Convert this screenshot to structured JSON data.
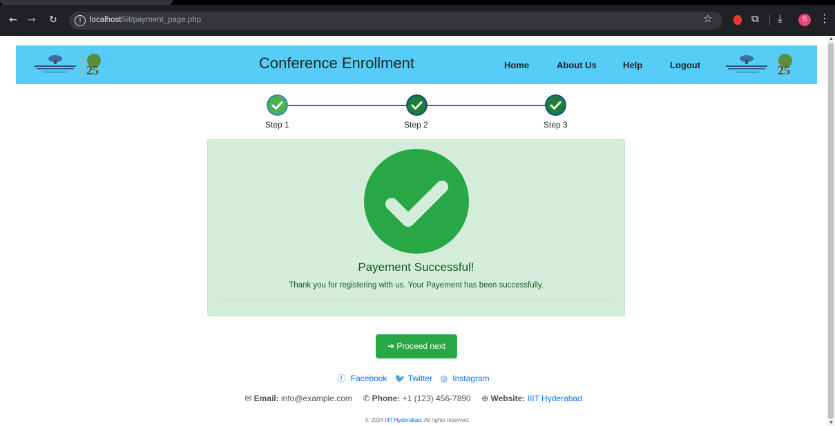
{
  "browser": {
    "url_host": "localhost",
    "url_path": "/iiit/payment_page.php",
    "avatar_letter": "S"
  },
  "header": {
    "brand": "Conference Enrollment",
    "nav": {
      "home": "Home",
      "about": "About Us",
      "help": "Help",
      "logout": "Logout"
    }
  },
  "steps": [
    {
      "label": "Step 1",
      "status": "completed"
    },
    {
      "label": "Step 2",
      "status": "completed"
    },
    {
      "label": "Step 3",
      "status": "completed"
    }
  ],
  "success": {
    "title": "Payement Successful!",
    "message": "Thank you for registering with us. Your Payement has been successfully."
  },
  "proceed_button": "➔ Proceed next",
  "footer": {
    "social": {
      "facebook": "Facebook",
      "twitter": "Twitter",
      "instagram": "Instagram"
    },
    "contact": {
      "email_label": "Email:",
      "email_value": "info@example.com",
      "phone_label": "Phone:",
      "phone_value": "+1 (123) 456-7890",
      "website_label": "Website:",
      "website_value": "IIIT Hyderabad"
    },
    "copyright_prefix": "© 2024",
    "copyright_link": "IIIT Hyderabad",
    "copyright_suffix": ". All rights reserved."
  },
  "colors": {
    "header_bg": "#56cdf7",
    "step_light": "#4caf50",
    "step_dark": "#1e7e34",
    "step_border": "#0d47a1",
    "success_bg": "#d4edda",
    "success_check": "#28a745",
    "button": "#28a745",
    "link": "#0d6efd"
  }
}
